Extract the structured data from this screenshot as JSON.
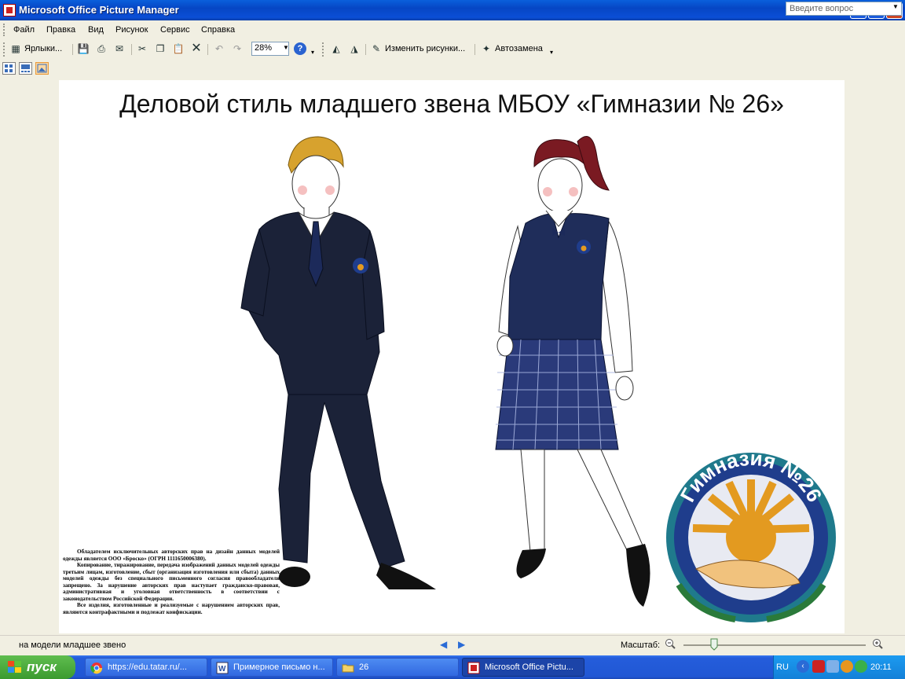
{
  "window": {
    "title": "Microsoft Office Picture Manager",
    "controls": {
      "minimize": "_",
      "restore": "❐",
      "close": "✕"
    }
  },
  "menu": {
    "items": [
      "Файл",
      "Правка",
      "Вид",
      "Рисунок",
      "Сервис",
      "Справка"
    ],
    "help_placeholder": "Введите вопрос"
  },
  "toolbar": {
    "shortcuts_label": "Ярлыки...",
    "zoom_value": "28%",
    "edit_pictures_label": "Изменить рисунки...",
    "autocorrect_label": "Автозамена",
    "icons": [
      "shortcuts-icon",
      "save-icon",
      "print-icon",
      "email-icon",
      "cut-icon",
      "copy-icon",
      "paste-icon",
      "delete-icon",
      "undo-icon",
      "redo-icon",
      "help-icon",
      "rotate-left-icon",
      "rotate-right-icon",
      "edit-pictures-icon",
      "autocorrect-icon"
    ]
  },
  "viewbar": {
    "buttons": [
      "thumbnail-view",
      "filmstrip-view",
      "single-picture-view"
    ],
    "active": "single-picture-view"
  },
  "picture": {
    "title": "Деловой стиль младшего звена МБОУ «Гимназии № 26»",
    "logo_text": "Гимназия №26",
    "copyright": [
      "Обладателем исключительных авторских прав на дизайн данных моделей одежды является ООО «Броско» (ОГРН 1111650006380).",
      "Копирование, тиражирование, передача изображений данных моделей одежды третьим лицам, изготовление, сбыт (организация изготовления или сбыта) данных моделей одежды без специального письменного согласия правообладателя запрещено. За нарушение авторских прав наступает гражданско-правовая, административная и уголовная ответственность в соответствии с законодательством Российской Федерации.",
      "Все изделия, изготовленные и реализуемые с нарушением авторских прав, являются контрафактными и подлежат конфискации."
    ]
  },
  "status": {
    "filename": "на модели младшее звено",
    "zoom_label": "Масштаб:",
    "zoom_level_fraction": 0.17
  },
  "taskbar": {
    "start_label": "пуск",
    "tasks": [
      {
        "label": "https://edu.tatar.ru/...",
        "icon": "chrome-icon"
      },
      {
        "label": "Примерное письмо н...",
        "icon": "word-icon"
      },
      {
        "label": "26",
        "icon": "folder-icon"
      },
      {
        "label": "Microsoft Office Pictu...",
        "icon": "picture-manager-icon",
        "active": true
      }
    ],
    "language": "RU",
    "clock": "20:11"
  },
  "colors": {
    "titlebar": "#0a5fdc",
    "chrome_bg": "#f1efe2",
    "taskbar": "#245ddb",
    "start_green": "#3b9a2f",
    "suit_navy": "#1b2238",
    "plaid_blue": "#2a3a7a",
    "logo_orange": "#e39a20",
    "logo_blue": "#1f3d8c"
  }
}
